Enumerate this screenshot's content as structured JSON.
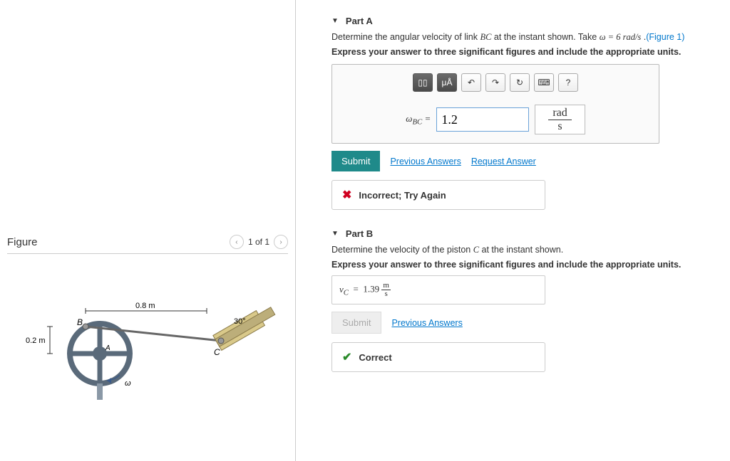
{
  "figure": {
    "title": "Figure",
    "pager": "1 of 1",
    "labels": {
      "B": "B",
      "C": "C",
      "A": "A",
      "omega_arc": "ω",
      "len_AB": "0.2 m",
      "len_BC": "0.8 m",
      "angle": "30°"
    }
  },
  "partA": {
    "title": "Part A",
    "prompt_pre": "Determine the angular velocity of link ",
    "prompt_var": "BC",
    "prompt_mid": " at the instant shown. Take ",
    "prompt_omega": "ω = 6 rad/s",
    "prompt_post": " .",
    "figure_link": "(Figure 1)",
    "express": "Express your answer to three significant figures and include the appropriate units.",
    "toolbar": {
      "templates": "▯▯",
      "units": "μÅ",
      "undo": "↶",
      "redo": "↷",
      "reset": "↻",
      "keyboard": "⌨",
      "help": "?"
    },
    "answer_label": "ω_BC =",
    "answer_value": "1.2",
    "unit_num": "rad",
    "unit_den": "s",
    "submit": "Submit",
    "prev_answers": "Previous Answers",
    "request_answer": "Request Answer",
    "feedback": "Incorrect; Try Again"
  },
  "partB": {
    "title": "Part B",
    "prompt_pre": "Determine the velocity of the piston ",
    "prompt_var": "C",
    "prompt_post": " at the instant shown.",
    "express": "Express your answer to three significant figures and include the appropriate units.",
    "answer_label": "v_C =",
    "answer_value": "1.39",
    "unit_num": "m",
    "unit_den": "s",
    "submit": "Submit",
    "prev_answers": "Previous Answers",
    "feedback": "Correct"
  }
}
